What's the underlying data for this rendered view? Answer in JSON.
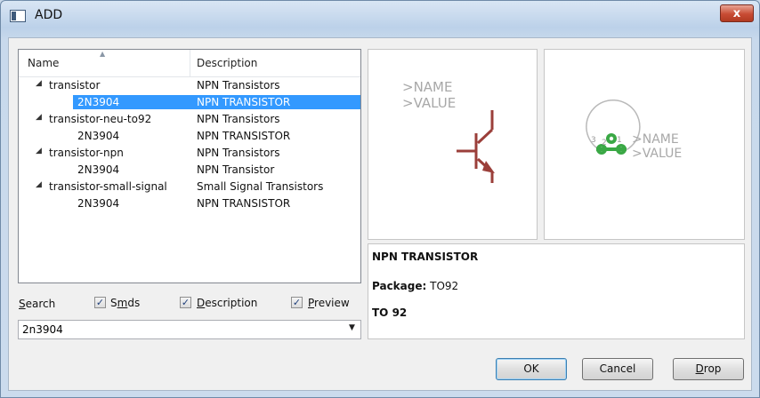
{
  "window": {
    "title": "ADD",
    "close_symbol": "x"
  },
  "list": {
    "columns": {
      "name": "Name",
      "description": "Description"
    },
    "rows": [
      {
        "name": "transistor",
        "description": "NPN Transistors",
        "indent": 0,
        "expanded": true,
        "selected": false
      },
      {
        "name": "2N3904",
        "description": "NPN TRANSISTOR",
        "indent": 1,
        "selected": true
      },
      {
        "name": "transistor-neu-to92",
        "description": "NPN Transistors",
        "indent": 0,
        "expanded": true,
        "selected": false
      },
      {
        "name": "2N3904",
        "description": "NPN TRANSISTOR",
        "indent": 1,
        "selected": false
      },
      {
        "name": "transistor-npn",
        "description": "NPN Transistors",
        "indent": 0,
        "expanded": true,
        "selected": false
      },
      {
        "name": "2N3904",
        "description": "NPN Transistor",
        "indent": 1,
        "selected": false
      },
      {
        "name": "transistor-small-signal",
        "description": "Small Signal Transistors",
        "indent": 0,
        "expanded": true,
        "selected": false
      },
      {
        "name": "2N3904",
        "description": "NPN TRANSISTOR",
        "indent": 1,
        "selected": false
      }
    ]
  },
  "search": {
    "label_first": "S",
    "label_rest": "earch",
    "value": "2n3904",
    "options": {
      "smds": {
        "first": "S",
        "under": "m",
        "rest": "ds",
        "checked": true
      },
      "description": {
        "under": "D",
        "rest": "escription",
        "checked": true
      },
      "preview": {
        "under": "P",
        "rest": "review",
        "checked": true
      }
    }
  },
  "symbol_preview": {
    "name": ">NAME",
    "value": ">VALUE"
  },
  "package_preview": {
    "name": ">NAME",
    "value": ">VALUE",
    "pad_labels": [
      "3",
      "2",
      "1"
    ]
  },
  "info": {
    "heading": "NPN TRANSISTOR",
    "package_label": "Package:",
    "package_value": "TO92",
    "package_heading": "TO 92"
  },
  "buttons": {
    "ok": "OK",
    "cancel": "Cancel",
    "drop_under": "D",
    "drop_rest": "rop"
  },
  "colors": {
    "selection": "#3399ff",
    "symbol": "#9b3f3a",
    "pad": "#3aa845"
  }
}
